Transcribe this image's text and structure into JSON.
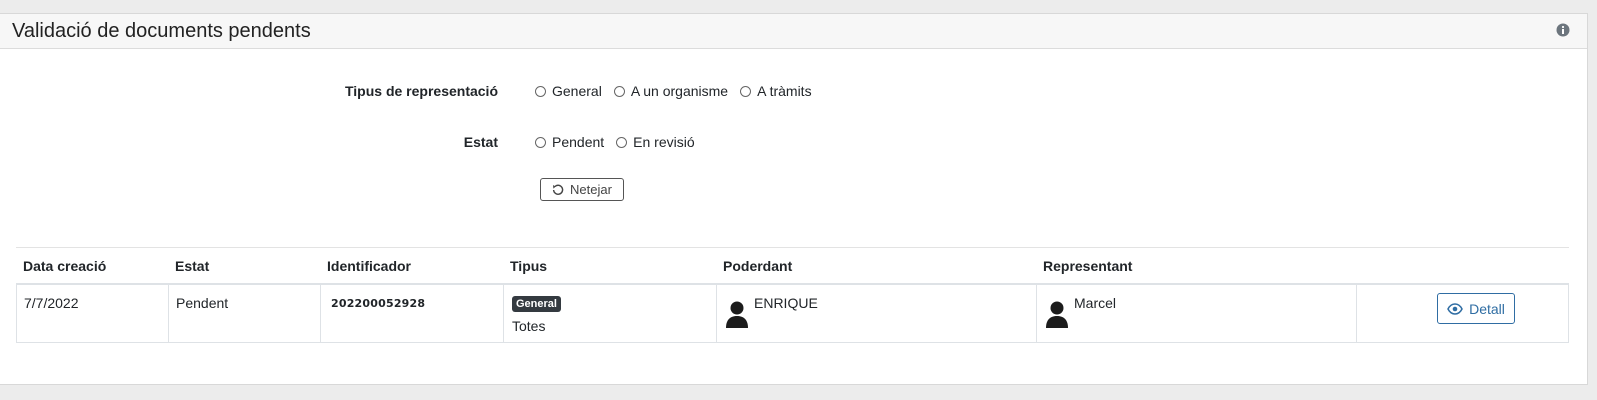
{
  "panel": {
    "title": "Validació de documents pendents"
  },
  "filters": {
    "representation": {
      "label": "Tipus de representació",
      "options": [
        "General",
        "A un organisme",
        "A tràmits"
      ]
    },
    "status": {
      "label": "Estat",
      "options": [
        "Pendent",
        "En revisió"
      ]
    },
    "clear_label": "Netejar"
  },
  "table": {
    "headers": [
      "Data creació",
      "Estat",
      "Identificador",
      "Tipus",
      "Poderdant",
      "Representant"
    ],
    "rows": [
      {
        "date": "7/7/2022",
        "status": "Pendent",
        "identifier": "202200052928",
        "type_badge": "General",
        "type_sub": "Totes",
        "grantor": "ENRIQUE",
        "representative": "Marcel",
        "detail_label": "Detall"
      }
    ]
  },
  "colors": {
    "accent": "#2f6da3",
    "badge": "#343a40",
    "header_bg": "#f7f7f7"
  },
  "icons": {
    "info": "info-circle-icon",
    "reset": "rotate-left-icon",
    "person": "user-icon",
    "eye": "eye-icon"
  }
}
